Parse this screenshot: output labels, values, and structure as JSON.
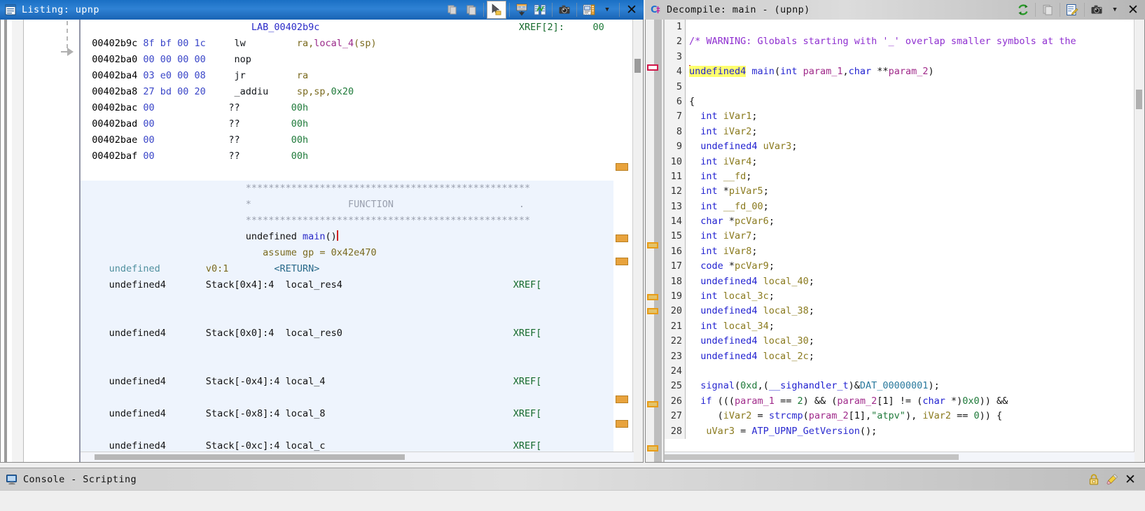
{
  "listing": {
    "title": "Listing:  upnp",
    "icon": "listing-icon",
    "toolbar": [
      {
        "name": "snapshot-disabled-icon",
        "glyph": "copy"
      },
      {
        "name": "copy-window-icon",
        "glyph": "copy2"
      },
      {
        "name": "cursor-select-icon",
        "glyph": "cursor"
      },
      {
        "name": "diff-navigate-icon",
        "glyph": "table-down"
      },
      {
        "name": "code-compare-icon",
        "glyph": "compare"
      },
      {
        "name": "camera-snapshot-icon",
        "glyph": "camera"
      },
      {
        "name": "toggle-fields-icon",
        "glyph": "fields"
      },
      {
        "name": "dropdown-caret-icon",
        "glyph": "caret"
      },
      {
        "name": "close-window-icon",
        "glyph": "close"
      }
    ],
    "rows": [
      {
        "type": "label",
        "highlight": false,
        "cells": [
          {
            "c": "c-label",
            "t": "                              LAB_00402b9c                                   "
          },
          {
            "c": "c-xref",
            "t": "XREF[2]:     "
          },
          {
            "c": "c-num",
            "t": "00"
          }
        ]
      },
      {
        "type": "code",
        "highlight": false,
        "cells": [
          {
            "c": "c-addr",
            "t": "  00402b9c "
          },
          {
            "c": "c-bytes",
            "t": "8f bf 00 1c"
          },
          {
            "c": "c-mnem",
            "t": "     lw         "
          },
          {
            "c": "c-reg",
            "t": "ra,"
          },
          {
            "c": "c-var",
            "t": "local_4"
          },
          {
            "c": "c-reg",
            "t": "(sp)"
          }
        ]
      },
      {
        "type": "code",
        "highlight": false,
        "cells": [
          {
            "c": "c-addr",
            "t": "  00402ba0 "
          },
          {
            "c": "c-bytes",
            "t": "00 00 00 00"
          },
          {
            "c": "c-mnem",
            "t": "     nop"
          }
        ]
      },
      {
        "type": "code",
        "highlight": false,
        "cells": [
          {
            "c": "c-addr",
            "t": "  00402ba4 "
          },
          {
            "c": "c-bytes",
            "t": "03 e0 00 08"
          },
          {
            "c": "c-mnem",
            "t": "     jr         "
          },
          {
            "c": "c-reg",
            "t": "ra"
          }
        ]
      },
      {
        "type": "code",
        "highlight": false,
        "cells": [
          {
            "c": "c-addr",
            "t": "  00402ba8 "
          },
          {
            "c": "c-bytes",
            "t": "27 bd 00 20"
          },
          {
            "c": "c-mnem",
            "t": "     _addiu     "
          },
          {
            "c": "c-reg",
            "t": "sp,sp,"
          },
          {
            "c": "c-num",
            "t": "0x20"
          }
        ]
      },
      {
        "type": "code",
        "highlight": false,
        "cells": [
          {
            "c": "c-addr",
            "t": "  00402bac "
          },
          {
            "c": "c-bytes",
            "t": "00"
          },
          {
            "c": "c-mnem",
            "t": "             ??         "
          },
          {
            "c": "c-num",
            "t": "00h"
          }
        ]
      },
      {
        "type": "code",
        "highlight": false,
        "cells": [
          {
            "c": "c-addr",
            "t": "  00402bad "
          },
          {
            "c": "c-bytes",
            "t": "00"
          },
          {
            "c": "c-mnem",
            "t": "             ??         "
          },
          {
            "c": "c-num",
            "t": "00h"
          }
        ]
      },
      {
        "type": "code",
        "highlight": false,
        "cells": [
          {
            "c": "c-addr",
            "t": "  00402bae "
          },
          {
            "c": "c-bytes",
            "t": "00"
          },
          {
            "c": "c-mnem",
            "t": "             ??         "
          },
          {
            "c": "c-num",
            "t": "00h"
          }
        ]
      },
      {
        "type": "code",
        "highlight": false,
        "cells": [
          {
            "c": "c-addr",
            "t": "  00402baf "
          },
          {
            "c": "c-bytes",
            "t": "00"
          },
          {
            "c": "c-mnem",
            "t": "             ??         "
          },
          {
            "c": "c-num",
            "t": "00h"
          }
        ]
      },
      {
        "type": "blank",
        "highlight": false,
        "cells": []
      },
      {
        "type": "plate",
        "highlight": true,
        "cells": [
          {
            "c": "c-plate",
            "t": "                             **************************************************"
          }
        ]
      },
      {
        "type": "plate",
        "highlight": true,
        "cells": [
          {
            "c": "c-plate",
            "t": "                             *                 FUNCTION                      ."
          }
        ]
      },
      {
        "type": "plate",
        "highlight": true,
        "cells": [
          {
            "c": "c-plate",
            "t": "                             **************************************************"
          }
        ]
      },
      {
        "type": "sig",
        "highlight": true,
        "cells": [
          {
            "c": "c-type2",
            "t": "                             undefined "
          },
          {
            "c": "c-fn",
            "t": "main"
          },
          {
            "c": "c-type2",
            "t": "()"
          },
          {
            "c": "caret",
            "t": ""
          }
        ]
      },
      {
        "type": "assume",
        "highlight": true,
        "cells": [
          {
            "c": "c-kw",
            "t": "                                assume gp = 0x42e470"
          }
        ]
      },
      {
        "type": "var",
        "highlight": true,
        "cells": [
          {
            "c": "c-type",
            "t": "     undefined     "
          },
          {
            "c": "c-kw",
            "t": "   v0:1        "
          },
          {
            "c": "c-ret",
            "t": "<RETURN>"
          }
        ]
      },
      {
        "type": "var",
        "highlight": true,
        "cells": [
          {
            "c": "c-type2",
            "t": "     undefined4       Stack[0x4]:4  local_res4                              "
          },
          {
            "c": "c-xref",
            "t": "XREF["
          }
        ]
      },
      {
        "type": "blank-hl",
        "highlight": true,
        "cells": []
      },
      {
        "type": "blank-hl",
        "highlight": true,
        "cells": []
      },
      {
        "type": "var",
        "highlight": true,
        "cells": [
          {
            "c": "c-type2",
            "t": "     undefined4       Stack[0x0]:4  local_res0                              "
          },
          {
            "c": "c-xref",
            "t": "XREF["
          }
        ]
      },
      {
        "type": "blank-hl",
        "highlight": true,
        "cells": []
      },
      {
        "type": "blank-hl",
        "highlight": true,
        "cells": []
      },
      {
        "type": "var",
        "highlight": true,
        "cells": [
          {
            "c": "c-type2",
            "t": "     undefined4       Stack[-0x4]:4 local_4                                 "
          },
          {
            "c": "c-xref",
            "t": "XREF["
          }
        ]
      },
      {
        "type": "blank-hl",
        "highlight": true,
        "cells": []
      },
      {
        "type": "var",
        "highlight": true,
        "cells": [
          {
            "c": "c-type2",
            "t": "     undefined4       Stack[-0x8]:4 local_8                                 "
          },
          {
            "c": "c-xref",
            "t": "XREF["
          }
        ]
      },
      {
        "type": "blank-hl",
        "highlight": true,
        "cells": []
      },
      {
        "type": "var",
        "highlight": true,
        "cells": [
          {
            "c": "c-type2",
            "t": "     undefined4       Stack[-0xc]:4 local_c                                 "
          },
          {
            "c": "c-xref",
            "t": "XREF["
          }
        ]
      }
    ]
  },
  "decompile": {
    "title": "Decompile: main -  (upnp)",
    "icon": "decompile-c-icon",
    "toolbar": [
      {
        "name": "refresh-icon",
        "glyph": "refresh"
      },
      {
        "name": "copy-icon",
        "glyph": "copy2"
      },
      {
        "name": "edit-signature-icon",
        "glyph": "edit"
      },
      {
        "name": "camera-snapshot-icon",
        "glyph": "camera"
      },
      {
        "name": "dropdown-caret-icon",
        "glyph": "caret"
      },
      {
        "name": "close-window-icon",
        "glyph": "close"
      }
    ],
    "lines": [
      {
        "n": "1",
        "parts": []
      },
      {
        "n": "2",
        "parts": [
          {
            "c": "d-cmt",
            "t": "/* WARNING: Globals starting with '_' overlap smaller symbols at the"
          }
        ]
      },
      {
        "n": "3",
        "parts": []
      },
      {
        "n": "4",
        "parts": [
          {
            "c": "dcaret",
            "t": ""
          },
          {
            "c": "d-type d-hl",
            "t": "undefined4"
          },
          {
            "c": "d-punc",
            "t": " "
          },
          {
            "c": "d-fn",
            "t": "main"
          },
          {
            "c": "d-punc",
            "t": "("
          },
          {
            "c": "d-type",
            "t": "int"
          },
          {
            "c": "d-punc",
            "t": " "
          },
          {
            "c": "d-param",
            "t": "param_1"
          },
          {
            "c": "d-punc",
            "t": ","
          },
          {
            "c": "d-type",
            "t": "char"
          },
          {
            "c": "d-punc",
            "t": " **"
          },
          {
            "c": "d-param",
            "t": "param_2"
          },
          {
            "c": "d-punc",
            "t": ")"
          }
        ]
      },
      {
        "n": "5",
        "parts": []
      },
      {
        "n": "6",
        "parts": [
          {
            "c": "d-punc",
            "t": "{"
          }
        ]
      },
      {
        "n": "7",
        "parts": [
          {
            "c": "d-type",
            "t": "  int"
          },
          {
            "c": "d-name",
            "t": " iVar1"
          },
          {
            "c": "d-punc",
            "t": ";"
          }
        ]
      },
      {
        "n": "8",
        "parts": [
          {
            "c": "d-type",
            "t": "  int"
          },
          {
            "c": "d-name",
            "t": " iVar2"
          },
          {
            "c": "d-punc",
            "t": ";"
          }
        ]
      },
      {
        "n": "9",
        "parts": [
          {
            "c": "d-type",
            "t": "  undefined4"
          },
          {
            "c": "d-name",
            "t": " uVar3"
          },
          {
            "c": "d-punc",
            "t": ";"
          }
        ]
      },
      {
        "n": "10",
        "parts": [
          {
            "c": "d-type",
            "t": "  int"
          },
          {
            "c": "d-name",
            "t": " iVar4"
          },
          {
            "c": "d-punc",
            "t": ";"
          }
        ]
      },
      {
        "n": "11",
        "parts": [
          {
            "c": "d-type",
            "t": "  int"
          },
          {
            "c": "d-name",
            "t": " __fd"
          },
          {
            "c": "d-punc",
            "t": ";"
          }
        ]
      },
      {
        "n": "12",
        "parts": [
          {
            "c": "d-type",
            "t": "  int"
          },
          {
            "c": "d-punc",
            "t": " *"
          },
          {
            "c": "d-name",
            "t": "piVar5"
          },
          {
            "c": "d-punc",
            "t": ";"
          }
        ]
      },
      {
        "n": "13",
        "parts": [
          {
            "c": "d-type",
            "t": "  int"
          },
          {
            "c": "d-name",
            "t": " __fd_00"
          },
          {
            "c": "d-punc",
            "t": ";"
          }
        ]
      },
      {
        "n": "14",
        "parts": [
          {
            "c": "d-type",
            "t": "  char"
          },
          {
            "c": "d-punc",
            "t": " *"
          },
          {
            "c": "d-name",
            "t": "pcVar6"
          },
          {
            "c": "d-punc",
            "t": ";"
          }
        ]
      },
      {
        "n": "15",
        "parts": [
          {
            "c": "d-type",
            "t": "  int"
          },
          {
            "c": "d-name",
            "t": " iVar7"
          },
          {
            "c": "d-punc",
            "t": ";"
          }
        ]
      },
      {
        "n": "16",
        "parts": [
          {
            "c": "d-type",
            "t": "  int"
          },
          {
            "c": "d-name",
            "t": " iVar8"
          },
          {
            "c": "d-punc",
            "t": ";"
          }
        ]
      },
      {
        "n": "17",
        "parts": [
          {
            "c": "d-type",
            "t": "  code"
          },
          {
            "c": "d-punc",
            "t": " *"
          },
          {
            "c": "d-name",
            "t": "pcVar9"
          },
          {
            "c": "d-punc",
            "t": ";"
          }
        ]
      },
      {
        "n": "18",
        "parts": [
          {
            "c": "d-type",
            "t": "  undefined4"
          },
          {
            "c": "d-name",
            "t": " local_40"
          },
          {
            "c": "d-punc",
            "t": ";"
          }
        ]
      },
      {
        "n": "19",
        "parts": [
          {
            "c": "d-type",
            "t": "  int"
          },
          {
            "c": "d-name",
            "t": " local_3c"
          },
          {
            "c": "d-punc",
            "t": ";"
          }
        ]
      },
      {
        "n": "20",
        "parts": [
          {
            "c": "d-type",
            "t": "  undefined4"
          },
          {
            "c": "d-name",
            "t": " local_38"
          },
          {
            "c": "d-punc",
            "t": ";"
          }
        ]
      },
      {
        "n": "21",
        "parts": [
          {
            "c": "d-type",
            "t": "  int"
          },
          {
            "c": "d-name",
            "t": " local_34"
          },
          {
            "c": "d-punc",
            "t": ";"
          }
        ]
      },
      {
        "n": "22",
        "parts": [
          {
            "c": "d-type",
            "t": "  undefined4"
          },
          {
            "c": "d-name",
            "t": " local_30"
          },
          {
            "c": "d-punc",
            "t": ";"
          }
        ]
      },
      {
        "n": "23",
        "parts": [
          {
            "c": "d-type",
            "t": "  undefined4"
          },
          {
            "c": "d-name",
            "t": " local_2c"
          },
          {
            "c": "d-punc",
            "t": ";"
          }
        ]
      },
      {
        "n": "24",
        "parts": []
      },
      {
        "n": "25",
        "parts": [
          {
            "c": "d-fn",
            "t": "  signal"
          },
          {
            "c": "d-punc",
            "t": "("
          },
          {
            "c": "d-num",
            "t": "0xd"
          },
          {
            "c": "d-punc",
            "t": ",("
          },
          {
            "c": "d-type",
            "t": "__sighandler_t"
          },
          {
            "c": "d-punc",
            "t": ")&"
          },
          {
            "c": "d-glob",
            "t": "DAT_00000001"
          },
          {
            "c": "d-punc",
            "t": ");"
          }
        ]
      },
      {
        "n": "26",
        "parts": [
          {
            "c": "d-type",
            "t": "  if"
          },
          {
            "c": "d-punc",
            "t": " ((("
          },
          {
            "c": "d-param",
            "t": "param_1"
          },
          {
            "c": "d-punc",
            "t": " == "
          },
          {
            "c": "d-num",
            "t": "2"
          },
          {
            "c": "d-punc",
            "t": ") && ("
          },
          {
            "c": "d-param",
            "t": "param_2"
          },
          {
            "c": "d-punc",
            "t": "[1] != ("
          },
          {
            "c": "d-type",
            "t": "char"
          },
          {
            "c": "d-punc",
            "t": " *)"
          },
          {
            "c": "d-num",
            "t": "0x0"
          },
          {
            "c": "d-punc",
            "t": ")) &&"
          }
        ]
      },
      {
        "n": "27",
        "parts": [
          {
            "c": "d-punc",
            "t": "     ("
          },
          {
            "c": "d-name",
            "t": "iVar2"
          },
          {
            "c": "d-punc",
            "t": " = "
          },
          {
            "c": "d-fn",
            "t": "strcmp"
          },
          {
            "c": "d-punc",
            "t": "("
          },
          {
            "c": "d-param",
            "t": "param_2"
          },
          {
            "c": "d-punc",
            "t": "[1],"
          },
          {
            "c": "d-str",
            "t": "\"atpv\""
          },
          {
            "c": "d-punc",
            "t": "), "
          },
          {
            "c": "d-name",
            "t": "iVar2"
          },
          {
            "c": "d-punc",
            "t": " == "
          },
          {
            "c": "d-num",
            "t": "0"
          },
          {
            "c": "d-punc",
            "t": ")) {"
          }
        ]
      },
      {
        "n": "28",
        "parts": [
          {
            "c": "d-name",
            "t": "   uVar3"
          },
          {
            "c": "d-punc",
            "t": " = "
          },
          {
            "c": "d-fn",
            "t": "ATP_UPNP_GetVersion"
          },
          {
            "c": "d-punc",
            "t": "();"
          }
        ]
      }
    ]
  },
  "console": {
    "title": "Console - Scripting",
    "icon": "console-monitor-icon",
    "toolbar": [
      {
        "name": "lock-icon",
        "glyph": "lock"
      },
      {
        "name": "clear-console-icon",
        "glyph": "eraser"
      },
      {
        "name": "close-window-icon",
        "glyph": "close"
      }
    ]
  },
  "colors": {
    "title_active": "#1a6fc4",
    "highlight_row": "#eef4fd",
    "decomp_highlight": "#ffff6e",
    "caret": "#d02020",
    "marker_orange": "#e89c18",
    "marker_red": "#d0184a"
  }
}
